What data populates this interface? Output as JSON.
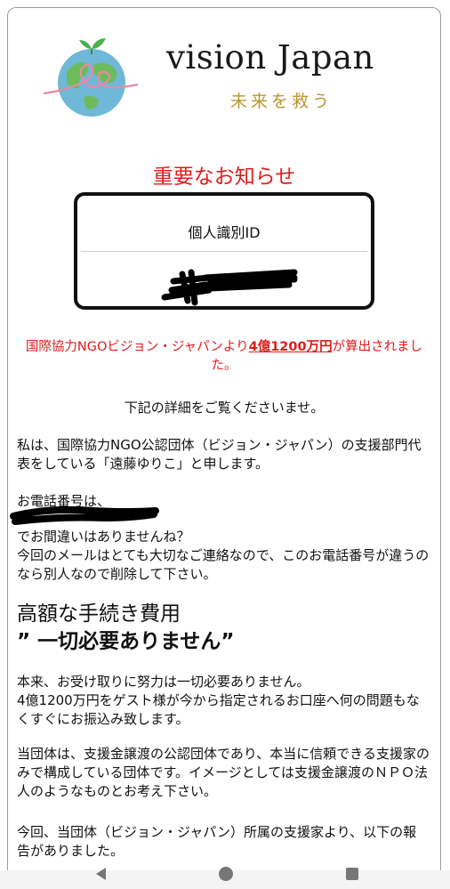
{
  "header": {
    "brand": "vision Japan",
    "tagline": "未来を救う"
  },
  "notice_title": "重要なお知らせ",
  "id_box": {
    "label": "個人識別ID"
  },
  "amount_notice": {
    "before": "国際協力NGOビジョン・ジャパンより",
    "amount": "4億1200万円",
    "after": "が算出されました。"
  },
  "detail_line": "下記の詳細をご覧くださいませ。",
  "paragraphs": {
    "intro": "私は、国際協力NGO公認団体（ビジョン・ジャパン）の支援部門代表をしている「遠藤ゆりこ」と申します。",
    "phone_label": "お電話番号は、",
    "phone_check": "でお間違いはありませんね？\n今回のメールはとても大切なご連絡なので、このお電話番号が違うのなら別人なので削除して下さい。",
    "heading_1": "高額な手続き費用",
    "heading_2": "” 一切必要ありません”",
    "receive": "本来、お受け取りに努力は一切必要ありません。\n4億1200万円をゲスト様が今から指定されるお口座へ何の問題もなくすぐにお振込み致します。",
    "org": "当団体は、支援金譲渡の公認団体であり、本当に信頼できる支援家のみで構成している団体です。イメージとしては支援金譲渡のＮＰＯ法人のようなものとお考え下さい。",
    "report": "今回、当団体（ビジョン・ジャパン）所属の支援家より、以下の報告がありました。"
  },
  "colors": {
    "alert": "#e11b1b",
    "tagline": "#b8962e"
  },
  "navbar": {
    "back_icon": "back-triangle-icon",
    "home_icon": "home-circle-icon",
    "recent_icon": "recent-square-icon"
  }
}
